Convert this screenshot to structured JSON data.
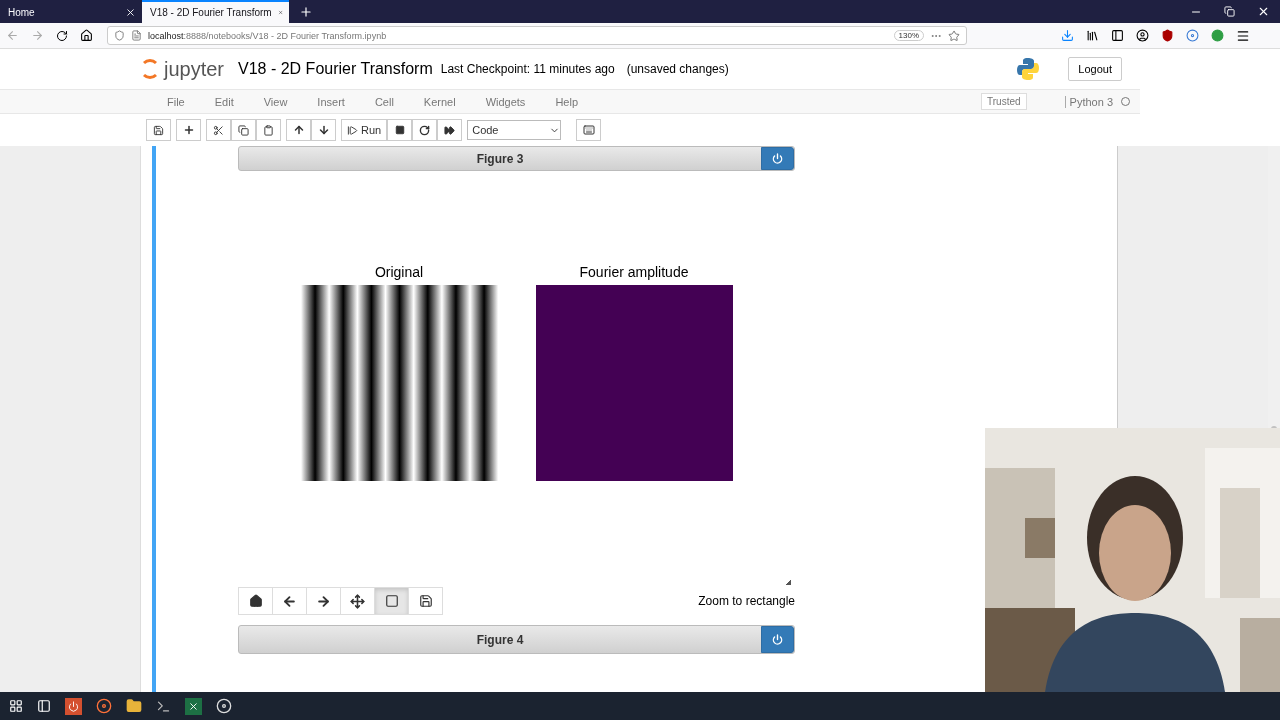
{
  "browser": {
    "tabs": [
      {
        "title": "Home",
        "selected": false
      },
      {
        "title": "V18 - 2D Fourier Transform",
        "selected": true
      }
    ],
    "url_host": "localhost",
    "url_path": ":8888/notebooks/V18 - 2D Fourier Transform.ipynb",
    "zoom": "130%"
  },
  "notebook": {
    "logo": "jupyter",
    "title": "V18 - 2D Fourier Transform",
    "checkpoint": "Last Checkpoint: 11 minutes ago",
    "status": "(unsaved changes)",
    "logout": "Logout",
    "menu": [
      "File",
      "Edit",
      "View",
      "Insert",
      "Cell",
      "Kernel",
      "Widgets",
      "Help"
    ],
    "trusted": "Trusted",
    "kernel": "Python 3",
    "run": "Run",
    "cell_type": "Code"
  },
  "figure_top": {
    "title": "Figure 3"
  },
  "plot": {
    "panels": [
      {
        "title": "Original",
        "kind": "stripes"
      },
      {
        "title": "Fourier amplitude",
        "kind": "amplitude"
      }
    ],
    "tools": [
      {
        "kind": "home",
        "selected": false
      },
      {
        "kind": "back",
        "selected": false
      },
      {
        "kind": "forward",
        "selected": false
      },
      {
        "kind": "pan",
        "selected": false
      },
      {
        "kind": "zoom",
        "selected": true
      },
      {
        "kind": "save",
        "selected": false
      }
    ],
    "message": "Zoom to rectangle"
  },
  "figure_bottom": {
    "title": "Figure 4"
  }
}
